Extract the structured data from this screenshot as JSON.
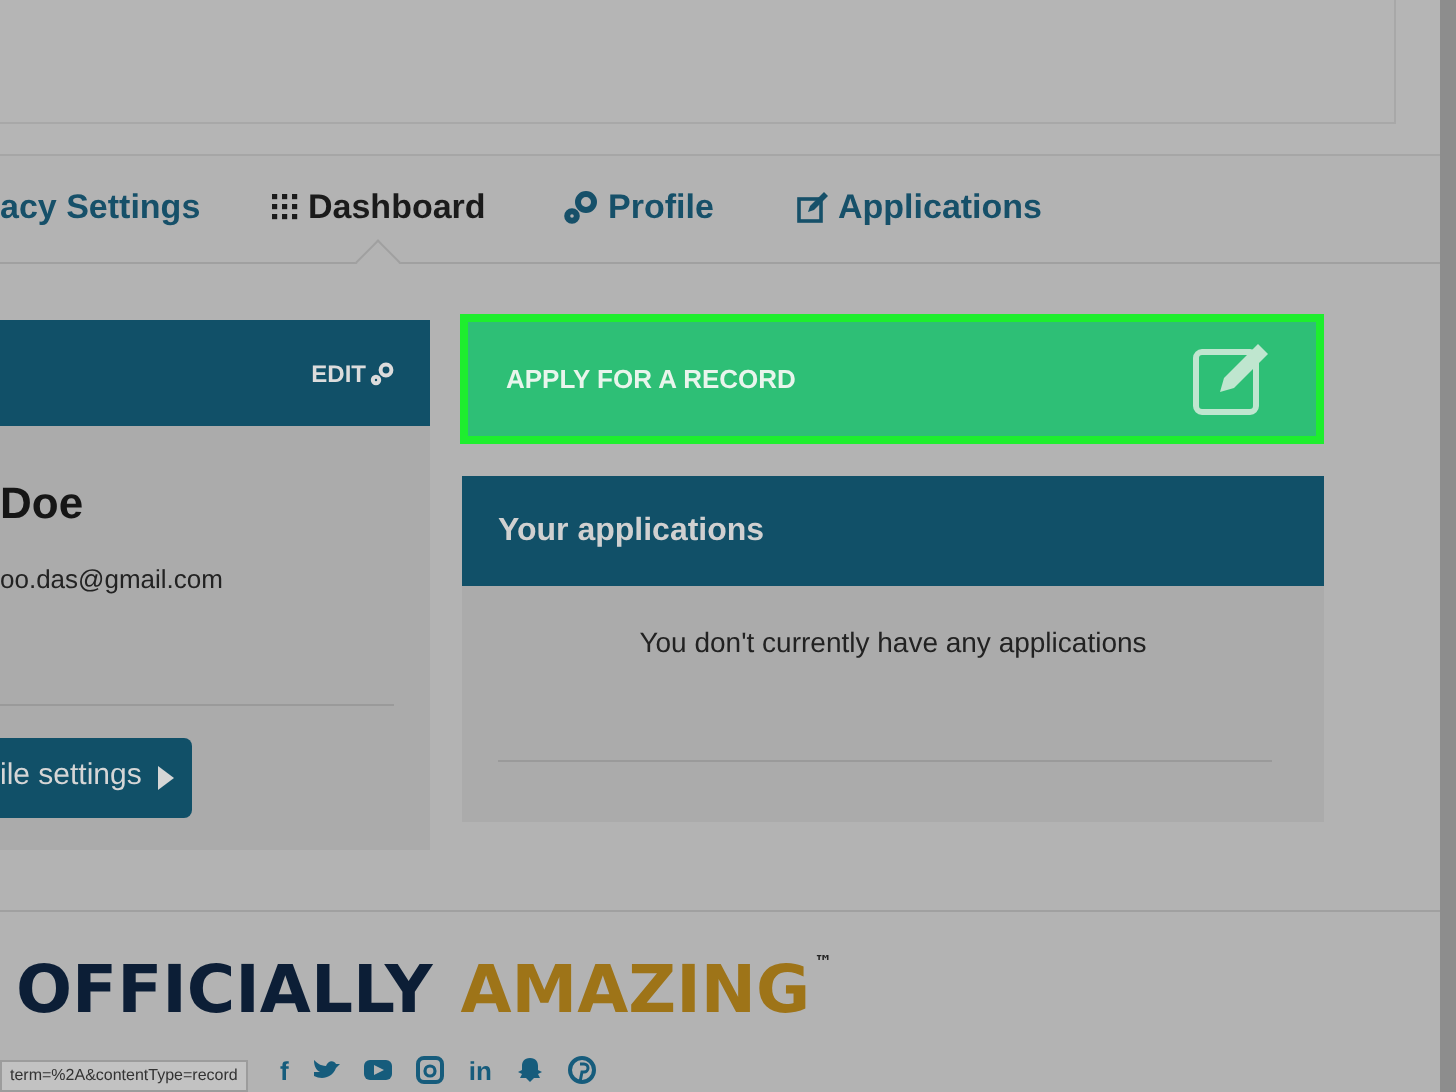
{
  "tabs": [
    {
      "label": "acy Settings",
      "selected": false
    },
    {
      "label": "Dashboard",
      "selected": true
    },
    {
      "label": "Profile",
      "selected": false
    },
    {
      "label": "Applications",
      "selected": false
    }
  ],
  "profile_card": {
    "edit": "EDIT",
    "name": "Doe",
    "email": "oo.das@gmail.com",
    "button": "ile settings"
  },
  "apply_button": {
    "label": "APPLY FOR A RECORD",
    "highlighted": true
  },
  "applications": {
    "title": "Your applications",
    "message": "You don't currently have any applications"
  },
  "footer": {
    "slogan_left": "OFFICIALLY",
    "slogan_right": "AMAZING",
    "trademark": "™",
    "social": [
      {
        "kind": "text",
        "glyph": "f"
      },
      {
        "kind": "bird"
      },
      {
        "kind": "play"
      },
      {
        "kind": "camera"
      },
      {
        "kind": "text",
        "glyph": "in"
      },
      {
        "kind": "ghost"
      },
      {
        "kind": "pin"
      }
    ]
  },
  "status_bar": "term=%2A&contentType=record"
}
